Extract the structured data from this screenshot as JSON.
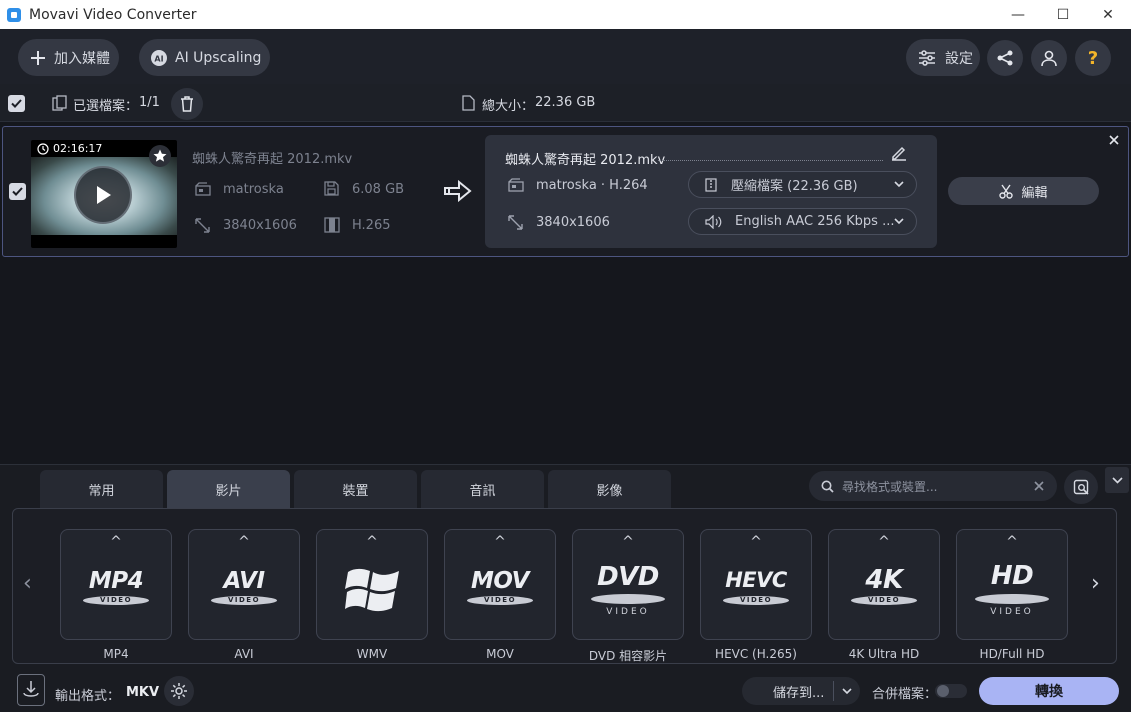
{
  "window": {
    "title": "Movavi Video Converter",
    "controls": [
      "—",
      "☐",
      "✕"
    ]
  },
  "toolbar": {
    "add_media_label": "加入媒體",
    "ai_upscaling_label": "AI Upscaling",
    "settings_label": "設定"
  },
  "selection_bar": {
    "selected_label": "已選檔案：",
    "selected_count": "1/1",
    "total_size_label": "總大小：",
    "total_size": "22.36 GB"
  },
  "file": {
    "duration": "02:16:17",
    "name": "蜘蛛人驚奇再起 2012.mkv",
    "container": "matroska",
    "size": "6.08 GB",
    "resolution": "3840x1606",
    "codec": "H.265",
    "output": {
      "name": "蜘蛛人驚奇再起 2012.mkv",
      "container_codec": "matroska · H.264",
      "resolution": "3840x1606",
      "compress_label": "壓縮檔案 (22.36 GB)",
      "audio_label": "English AAC 256 Kbps ..."
    },
    "edit_label": "編輯"
  },
  "format_panel": {
    "tabs": [
      {
        "label": "常用",
        "active": false
      },
      {
        "label": "影片",
        "active": true
      },
      {
        "label": "裝置",
        "active": false
      },
      {
        "label": "音訊",
        "active": false
      },
      {
        "label": "影像",
        "active": false
      }
    ],
    "search_placeholder": "尋找格式或裝置...",
    "formats": [
      {
        "logo": "MP4",
        "sub": "VIDEO",
        "label": "MP4"
      },
      {
        "logo": "AVI",
        "sub": "VIDEO",
        "label": "AVI"
      },
      {
        "logo": "",
        "sub": "",
        "label": "WMV"
      },
      {
        "logo": "MOV",
        "sub": "VIDEO",
        "label": "MOV"
      },
      {
        "logo": "DVD",
        "sub": "VIDEO",
        "label": "DVD 相容影片"
      },
      {
        "logo": "HEVC",
        "sub": "VIDEO",
        "label": "HEVC (H.265)"
      },
      {
        "logo": "4K",
        "sub": "VIDEO",
        "label": "4K Ultra HD"
      },
      {
        "logo": "HD",
        "sub": "VIDEO",
        "label": "HD/Full HD"
      }
    ]
  },
  "bottom_bar": {
    "output_format_label": "輸出格式：",
    "output_format": "MKV",
    "save_to_label": "儲存到...",
    "merge_label": "合併檔案：",
    "convert_label": "轉換"
  },
  "colors": {
    "accent": "#a9b4f4",
    "background": "#15171d",
    "panel": "#2e323d"
  }
}
